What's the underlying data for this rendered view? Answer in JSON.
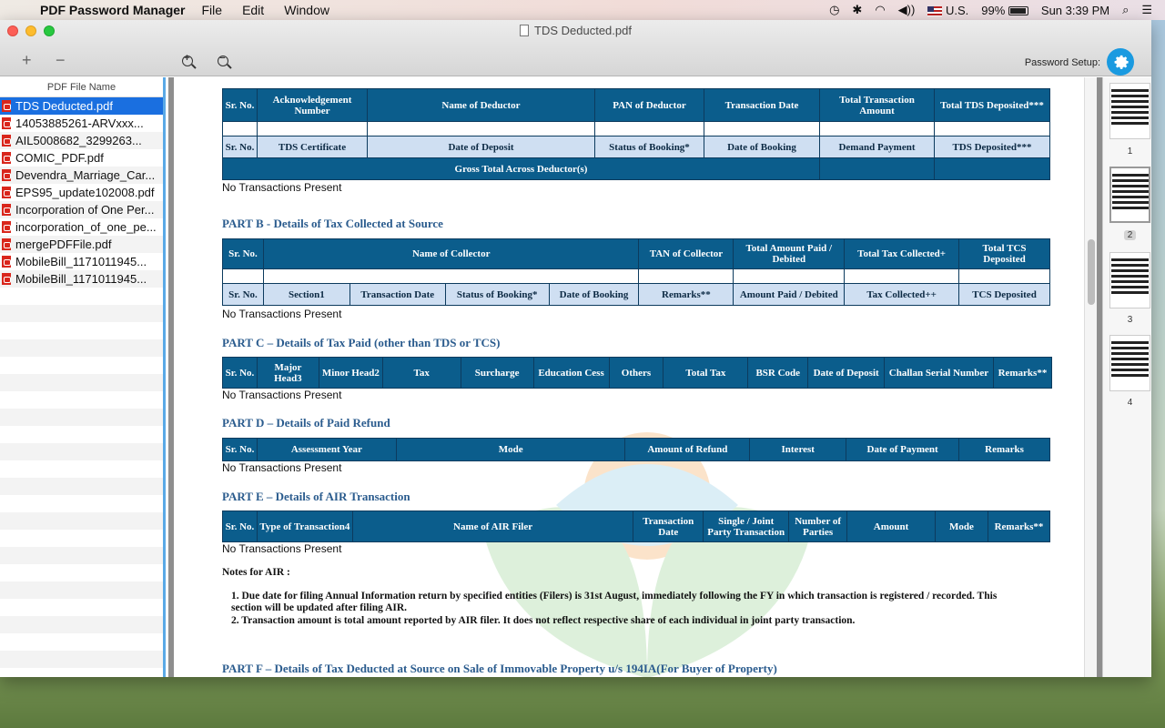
{
  "menubar": {
    "app_name": "PDF Password Manager",
    "menus": [
      "File",
      "Edit",
      "Window"
    ],
    "input_source": "U.S.",
    "battery": "99%",
    "clock": "Sun 3:39 PM"
  },
  "window": {
    "doc_title": "TDS Deducted.pdf",
    "password_setup_label": "Password Setup:"
  },
  "sidebar": {
    "header": "PDF File Name",
    "files": [
      "TDS Deducted.pdf",
      "14053885261-ARVxxx...",
      "AIL5008682_3299263...",
      "COMIC_PDF.pdf",
      "Devendra_Marriage_Car...",
      "EPS95_update102008.pdf",
      "Incorporation of One Per...",
      "incorporation_of_one_pe...",
      "mergePDFFile.pdf",
      "MobileBill_1171011945...",
      "MobileBill_1171011945..."
    ],
    "selected_index": 0
  },
  "document": {
    "no_tx": "No Transactions Present",
    "part_a2": {
      "header1": [
        "Sr. No.",
        "Acknowledgement Number",
        "Name of Deductor",
        "PAN of  Deductor",
        "Transaction Date",
        "Total Transaction Amount",
        "Total TDS Deposited***"
      ],
      "header2": [
        "Sr. No.",
        "TDS Certificate",
        "Date of Deposit",
        "Status of Booking*",
        "Date of Booking",
        "Demand Payment",
        "TDS Deposited***"
      ],
      "gross": "Gross Total Across Deductor(s)"
    },
    "part_b": {
      "title": "PART B - Details of Tax Collected at Source",
      "header1": [
        "Sr. No.",
        "Name of Collector",
        "TAN of Collector",
        "Total Amount Paid / Debited",
        "Total Tax Collected+",
        "Total TCS Deposited"
      ],
      "header2": [
        "Sr. No.",
        "Section1",
        "Transaction Date",
        "Status of Booking*",
        "Date of Booking",
        "Remarks**",
        "Amount Paid / Debited",
        "Tax Collected++",
        "TCS Deposited"
      ]
    },
    "part_c": {
      "title": "PART C – Details of Tax Paid (other than TDS or TCS)",
      "header": [
        "Sr. No.",
        "Major Head3",
        "Minor Head2",
        "Tax",
        "Surcharge",
        "Education Cess",
        "Others",
        "Total Tax",
        "BSR Code",
        "Date of Deposit",
        "Challan Serial Number",
        "Remarks**"
      ]
    },
    "part_d": {
      "title": "PART D  – Details of Paid Refund",
      "header": [
        "Sr. No.",
        "Assessment Year",
        "Mode",
        "Amount of Refund",
        "Interest",
        "Date of Payment",
        "Remarks"
      ]
    },
    "part_e": {
      "title": "PART E – Details of AIR Transaction",
      "header": [
        "Sr. No.",
        "Type of Transaction4",
        "Name of AIR Filer",
        "Transaction Date",
        "Single / Joint Party Transaction",
        "Number of Parties",
        "Amount",
        "Mode",
        "Remarks**"
      ],
      "notes_title": "Notes for AIR :",
      "note1": "1. Due date for filing Annual Information return by specified entities (Filers) is 31st August, immediately following the FY in which transaction is registered / recorded. This",
      "note1b": "section will be updated after filing AIR.",
      "note2": "2. Transaction amount is total amount reported by AIR filer. It does not reflect respective share of each individual in joint party transaction."
    },
    "part_f": {
      "title": "PART F – Details of Tax Deducted at Source on Sale of Immovable Property u/s 194IA(For Buyer of Property)"
    }
  },
  "thumbnails": [
    "1",
    "2",
    "3",
    "4"
  ],
  "colors": {
    "table_header": "#0b5d8c",
    "table_light": "#cfdff2",
    "part_title": "#2b5c8e",
    "selection": "#1a6fe0"
  }
}
